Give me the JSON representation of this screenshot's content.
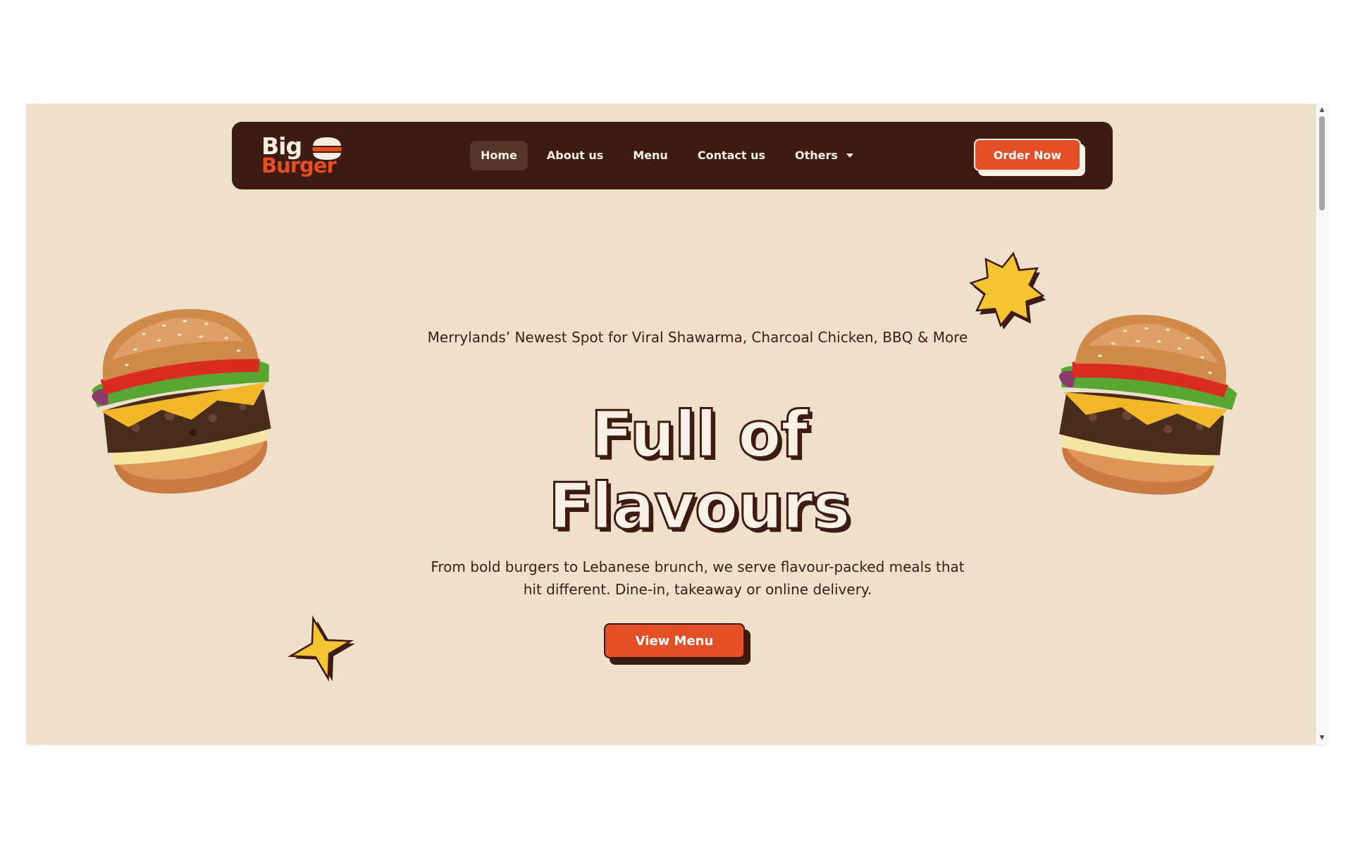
{
  "brand": {
    "logo_line1": "Big",
    "logo_line2": "Burger"
  },
  "nav": {
    "items": [
      {
        "label": "Home",
        "active": true
      },
      {
        "label": "About us"
      },
      {
        "label": "Menu"
      },
      {
        "label": "Contact us"
      },
      {
        "label": "Others",
        "dropdown": true
      }
    ],
    "cta_label": "Order Now"
  },
  "hero": {
    "tagline": "Merrylands’ Newest Spot for Viral Shawarma, Charcoal Chicken, BBQ & More",
    "title_line1": "Full of",
    "title_line2": "Flavours",
    "description": "From bold burgers to Lebanese brunch, we serve flavour-packed meals that hit different. Dine-in, takeaway or online delivery.",
    "cta_label": "View Menu"
  },
  "colors": {
    "background": "#efe0cc",
    "nav_background": "#3e1b12",
    "accent": "#e44f25",
    "cream": "#fbf1e6",
    "star_yellow": "#f4c531"
  },
  "icons": {
    "logo": "burger-logo-icon",
    "dropdown": "chevron-down-icon",
    "decor_star_burst": "star-burst-icon",
    "decor_star_four": "four-point-star-icon"
  }
}
